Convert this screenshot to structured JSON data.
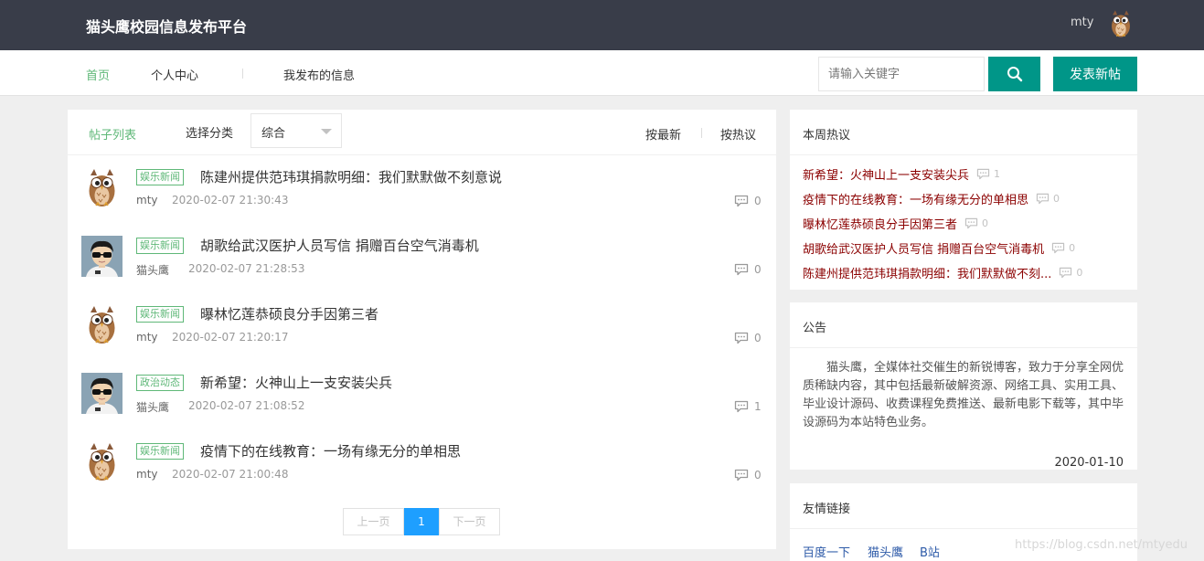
{
  "header": {
    "site_title": "猫头鹰校园信息发布平台",
    "username": "mty",
    "avatar_icon": "owl-avatar-icon"
  },
  "nav": {
    "items": [
      {
        "label": "首页",
        "active": true
      },
      {
        "label": "个人中心",
        "active": false
      },
      {
        "label": "我发布的信息",
        "active": false
      }
    ],
    "search_placeholder": "请输入关键字",
    "search_icon": "search-icon",
    "post_button": "发表新帖"
  },
  "list": {
    "title": "帖子列表",
    "category_label": "选择分类",
    "category_value": "综合",
    "sort_latest": "按最新",
    "sort_hot": "按热议",
    "posts": [
      {
        "avatar": "owl-avatar",
        "tag": "娱乐新闻",
        "title": "陈建州提供范玮琪捐款明细：我们默默做不刻意说",
        "author": "mty",
        "time": "2020-02-07 21:30:43",
        "comments": "0"
      },
      {
        "avatar": "boy-avatar",
        "tag": "娱乐新闻",
        "title": "胡歌给武汉医护人员写信 捐赠百台空气消毒机",
        "author": "猫头鹰",
        "time": "2020-02-07 21:28:53",
        "comments": "0"
      },
      {
        "avatar": "owl-avatar",
        "tag": "娱乐新闻",
        "title": "曝林忆莲恭硕良分手因第三者",
        "author": "mty",
        "time": "2020-02-07 21:20:17",
        "comments": "0"
      },
      {
        "avatar": "boy-avatar",
        "tag": "政治动态",
        "title": "新希望：火神山上一支安装尖兵",
        "author": "猫头鹰",
        "time": "2020-02-07 21:08:52",
        "comments": "1"
      },
      {
        "avatar": "owl-avatar",
        "tag": "娱乐新闻",
        "title": "疫情下的在线教育：一场有缘无分的单相思",
        "author": "mty",
        "time": "2020-02-07 21:00:48",
        "comments": "0"
      }
    ],
    "pager": {
      "prev": "上一页",
      "current": "1",
      "next": "下一页"
    }
  },
  "hot": {
    "title": "本周热议",
    "items": [
      {
        "title": "新希望：火神山上一支安装尖兵",
        "count": "1"
      },
      {
        "title": "疫情下的在线教育：一场有缘无分的单相思",
        "count": "0"
      },
      {
        "title": "曝林忆莲恭硕良分手因第三者",
        "count": "0"
      },
      {
        "title": "胡歌给武汉医护人员写信 捐赠百台空气消毒机",
        "count": "0"
      },
      {
        "title": "陈建州提供范玮琪捐款明细：我们默默做不刻...",
        "count": "0"
      }
    ]
  },
  "notice": {
    "title": "公告",
    "text": "猫头鹰，全媒体社交催生的新锐博客，致力于分享全网优质稀缺内容，其中包括最新破解资源、网络工具、实用工具、毕业设计源码、收费课程免费推送、最新电影下载等，其中毕设源码为本站特色业务。",
    "date": "2020-01-10"
  },
  "links": {
    "title": "友情链接",
    "items": [
      "百度一下",
      "猫头鹰",
      "B站"
    ]
  },
  "watermark": "https://blog.csdn.net/mtyedu",
  "colors": {
    "accent": "#009688",
    "green": "#5fb878",
    "topbar": "#393d49",
    "hot_title": "#8b0000",
    "pager_active": "#1e9fff"
  }
}
